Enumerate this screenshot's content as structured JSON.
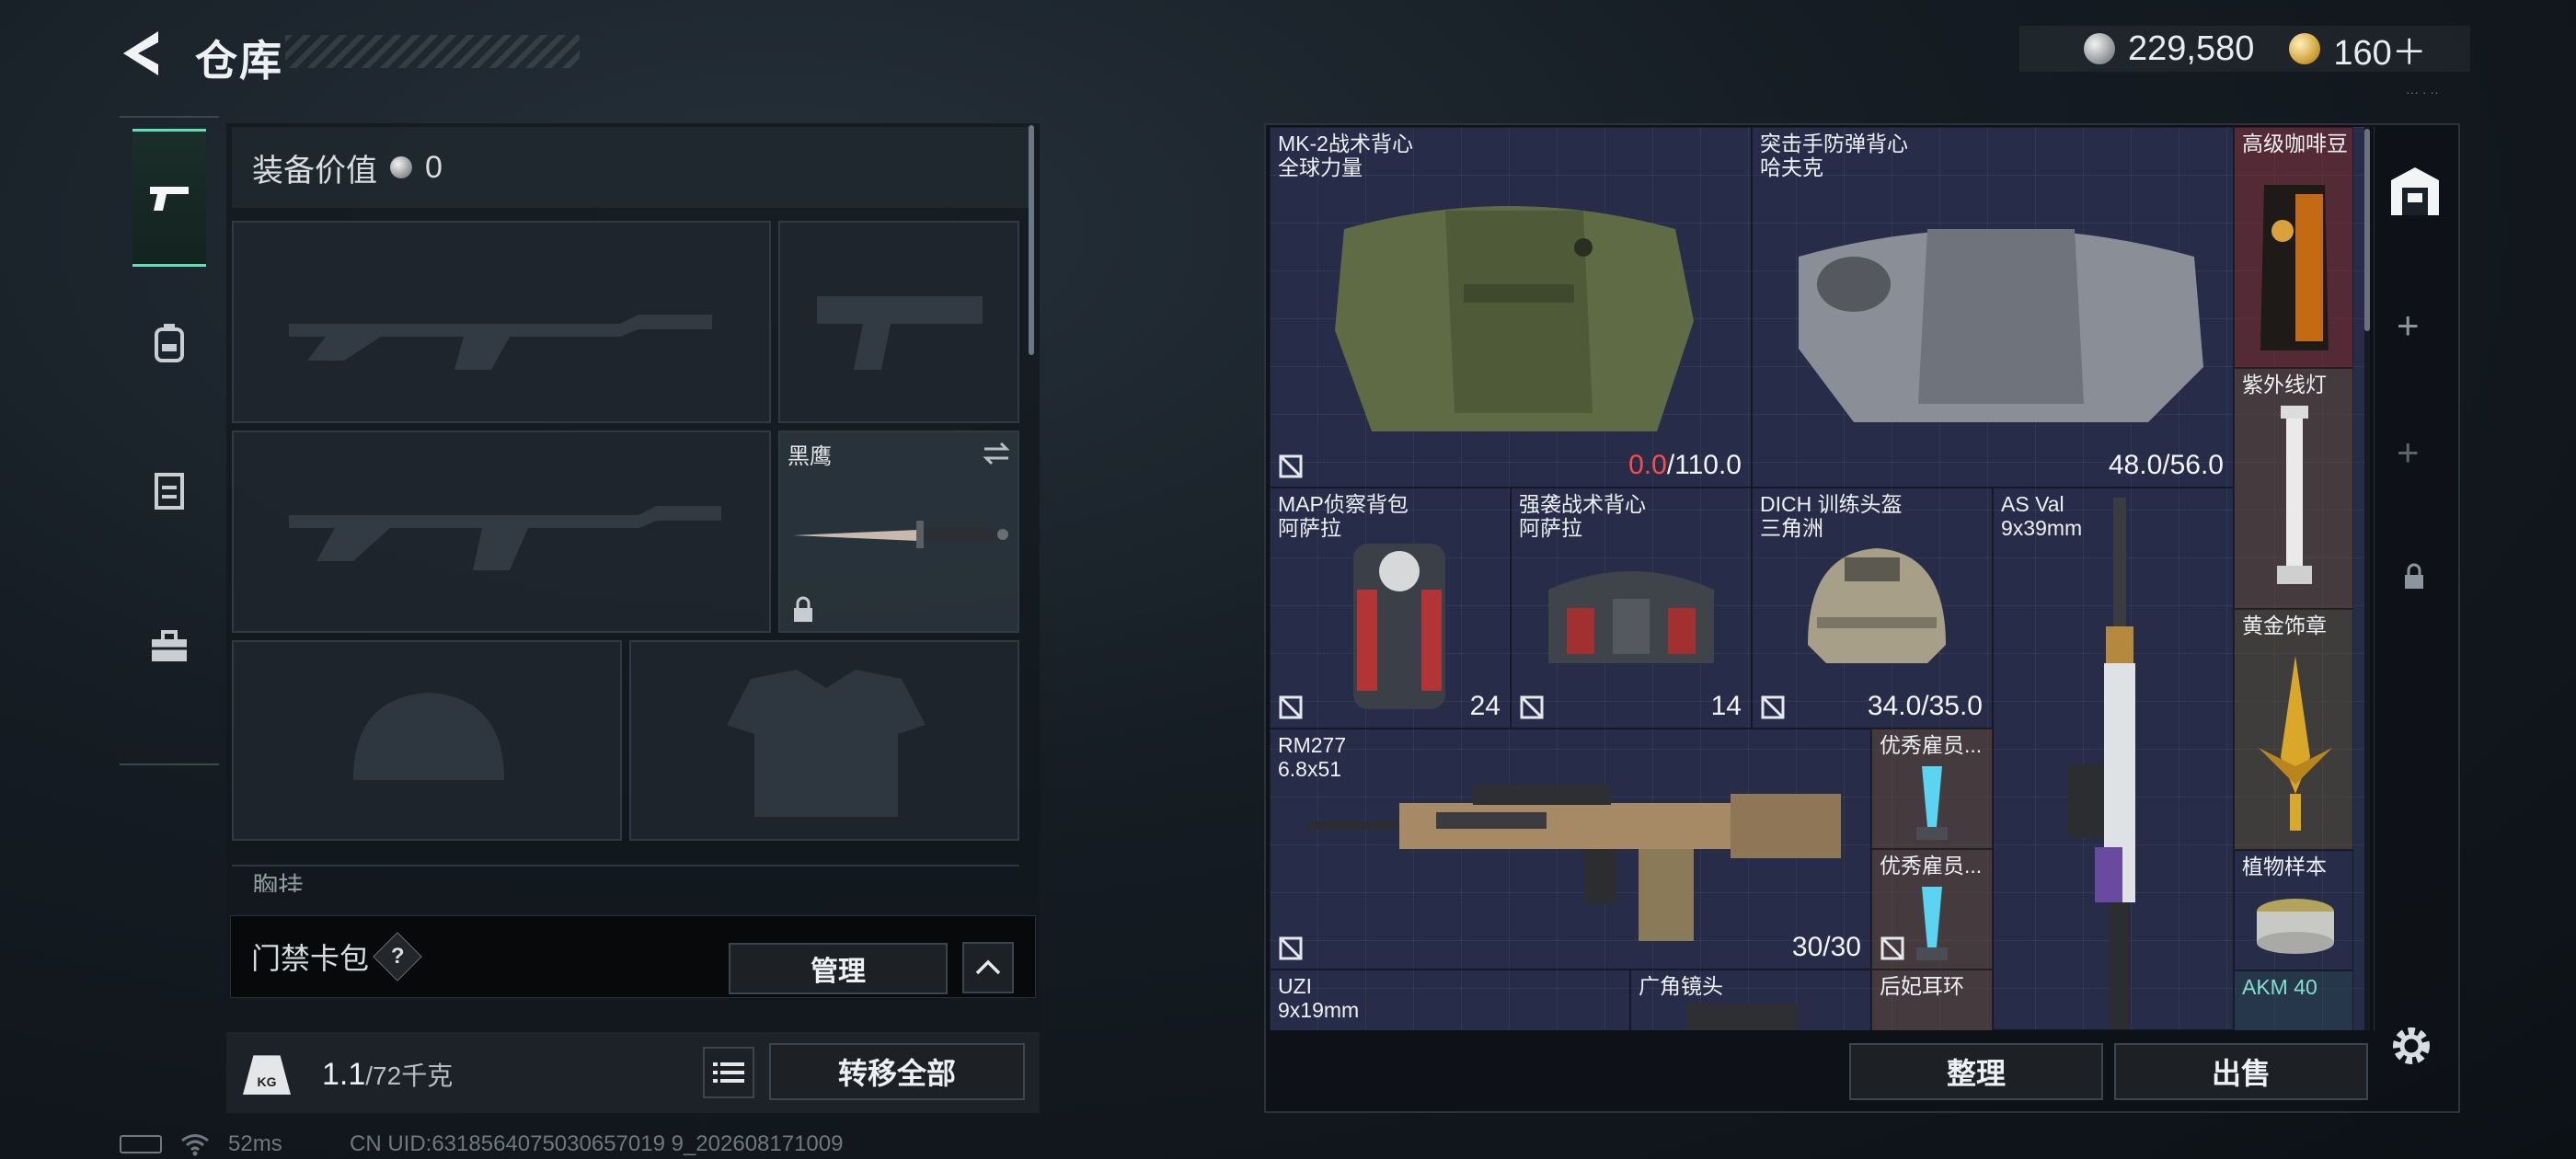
{
  "header": {
    "title": "仓库"
  },
  "currency": {
    "silver": "229,580",
    "gold": "160＋"
  },
  "left": {
    "equip_label": "装备价值",
    "equip_value": "0",
    "melee_name": "黑鹰",
    "chest_label": "胸挂",
    "keybag_label": "门禁卡包",
    "keybag_help": "?",
    "manage_label": "管理",
    "weight_current": "1.1",
    "weight_max": "/72千克",
    "weight_icon_text": "KG",
    "transfer_label": "转移全部"
  },
  "status": {
    "ping": "52ms",
    "uid": "CN UID:6318564075030657019 9_202608171009"
  },
  "items": [
    {
      "name": "MK-2战术背心",
      "sub": "全球力量",
      "val_red": "0.0",
      "val": "/110.0"
    },
    {
      "name": "突击手防弹背心",
      "sub": "哈夫克",
      "val": "48.0/56.0"
    },
    {
      "name": "高级咖啡豆"
    },
    {
      "name": "紫外线灯"
    },
    {
      "name": "MAP侦察背包",
      "sub": "阿萨拉",
      "val": "24"
    },
    {
      "name": "强袭战术背心",
      "sub": "阿萨拉",
      "val": "14"
    },
    {
      "name": "DICH 训练头盔",
      "sub": "三角洲",
      "val": "34.0/35.0"
    },
    {
      "name": "AS Val",
      "sub": "9x39mm"
    },
    {
      "name": "黄金饰章"
    },
    {
      "name": "RM277",
      "sub": "6.8x51",
      "val": "30/30"
    },
    {
      "name": "优秀雇员..."
    },
    {
      "name": "优秀雇员..."
    },
    {
      "name": "植物样本"
    },
    {
      "name": "UZI",
      "sub": "9x19mm"
    },
    {
      "name": "广角镜头"
    },
    {
      "name": "后妃耳环"
    },
    {
      "name": "AKM 40"
    }
  ],
  "actions": {
    "sort": "整理",
    "sell": "出售"
  },
  "colors": {
    "accent": "#59e3b7",
    "grid": "#272d48",
    "damage": "#ff4a4a"
  }
}
